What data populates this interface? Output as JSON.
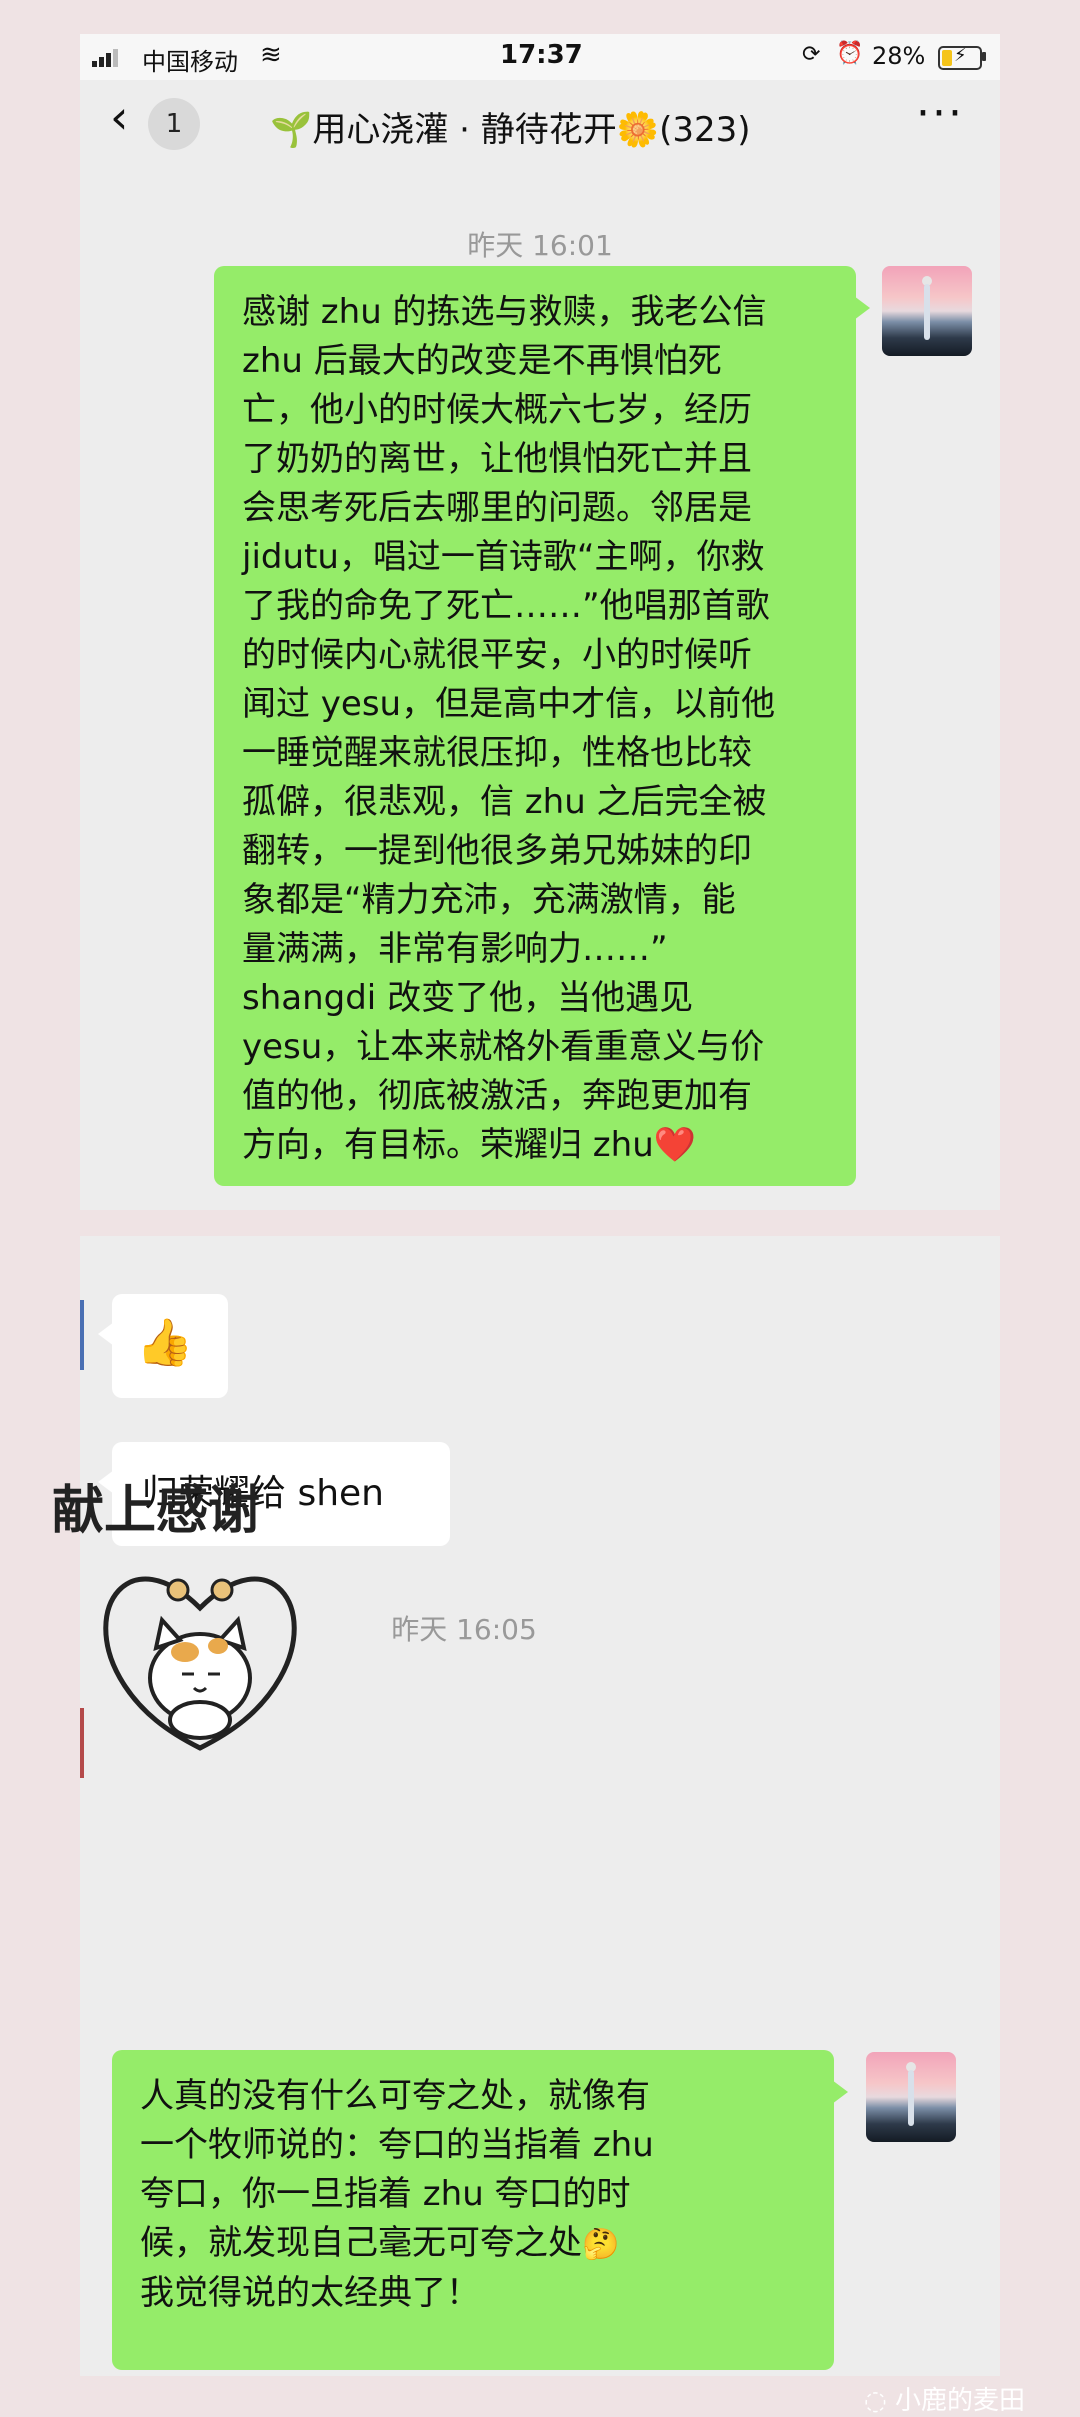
{
  "status_bar": {
    "carrier": "中国移动",
    "time": "17:37",
    "battery_percent": "28%",
    "battery_level": 0.28,
    "icons": [
      "signal-icon",
      "wifi-icon",
      "rotation-lock-icon",
      "alarm-icon",
      "battery-charging-icon"
    ]
  },
  "nav": {
    "back_badge": "1",
    "title_prefix": "🌱",
    "title": "用心浇灌 · 静待花开",
    "title_emoji": "🌼",
    "member_count": "(323)",
    "more": "···"
  },
  "messages_top": {
    "timestamp": "昨天 16:01",
    "bubble_lines": [
      "感谢 zhu 的拣选与救赎，我老公信",
      "zhu 后最大的改变是不再惧怕死",
      "亡，他小的时候大概六七岁，经历",
      "了奶奶的离世，让他惧怕死亡并且",
      "会思考死后去哪里的问题。邻居是",
      "jidutu，唱过一首诗歌“主啊，你救",
      "了我的命免了死亡……”他唱那首歌",
      "的时候内心就很平安，小的时候听",
      "闻过 yesu，但是高中才信，以前他",
      "一睡觉醒来就很压抑，性格也比较",
      "孤僻，很悲观，信 zhu 之后完全被",
      "翻转，一提到他很多弟兄姊妹的印",
      "象都是“精力充沛，充满激情，能",
      "量满满，非常有影响力……”",
      "shangdi 改变了他，当他遇见",
      "yesu，让本来就格外看重意义与价",
      "值的他，彻底被激活，奔跑更加有",
      "方向，有目标。荣耀归 zhu"
    ],
    "heart": "❤️"
  },
  "messages_bottom": {
    "thumbs_emoji": "👍",
    "reply_text": "归荣耀给 shen",
    "timestamp": "昨天 16:05",
    "sticker_caption": "献上感谢",
    "bubble_lines": [
      "人真的没有什么可夸之处，就像有",
      "一个牧师说的：夸口的当指着 zhu",
      "夸口，你一旦指着 zhu 夸口的时",
      "候，就发现自己毫无可夸之处",
      "我觉得说的太经典了！"
    ],
    "thinking_emoji": "🤔"
  },
  "watermark": {
    "text": "小鹿的麦田"
  }
}
